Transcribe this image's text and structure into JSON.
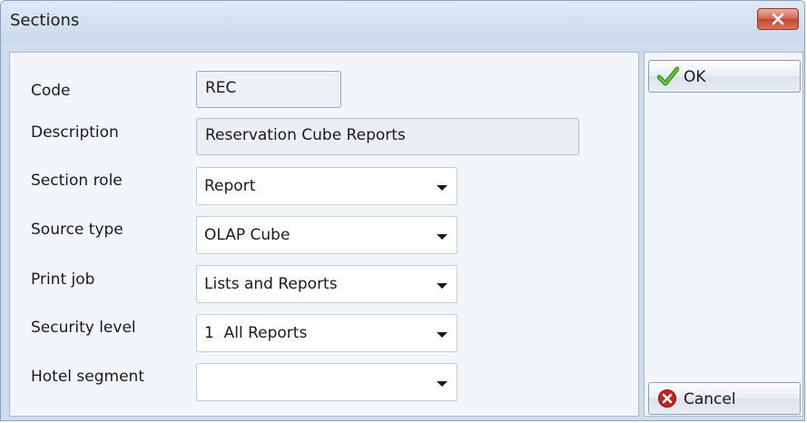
{
  "window": {
    "title": "Sections",
    "close_icon": "close-icon"
  },
  "form": {
    "code": {
      "label": "Code",
      "value": "REC"
    },
    "description": {
      "label": "Description",
      "value": "Reservation Cube Reports"
    },
    "section_role": {
      "label": "Section role",
      "value": "Report"
    },
    "source_type": {
      "label": "Source type",
      "value": "OLAP Cube"
    },
    "print_job": {
      "label": "Print job",
      "value": "Lists and Reports"
    },
    "security_level": {
      "label": "Security level",
      "value": "1  All Reports"
    },
    "hotel_segment": {
      "label": "Hotel segment",
      "value": ""
    }
  },
  "buttons": {
    "ok": {
      "label": "OK",
      "icon": "checkmark-icon"
    },
    "cancel": {
      "label": "Cancel",
      "icon": "cancel-icon"
    }
  },
  "colors": {
    "ok_icon": "#3c9a1f",
    "cancel_icon": "#c62020",
    "close_button": "#c9543c"
  }
}
